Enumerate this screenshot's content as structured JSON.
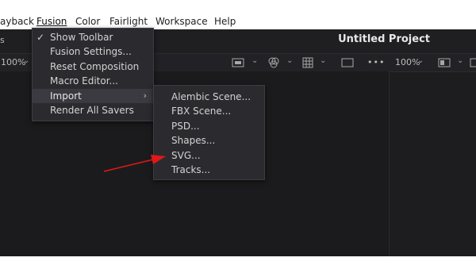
{
  "menubar": {
    "items": [
      "ayback",
      "Fusion",
      "Color",
      "Fairlight",
      "Workspace",
      "Help"
    ]
  },
  "project": {
    "title": "Untitled Project"
  },
  "toolbar": {
    "zoom_left": "100%",
    "zoom_right": "100%",
    "more": "•••"
  },
  "fusion_menu": {
    "items": [
      {
        "label": "Show Toolbar",
        "checked": true
      },
      {
        "label": "Fusion Settings..."
      },
      {
        "label": "Reset Composition"
      },
      {
        "label": "Macro Editor..."
      },
      {
        "label": "Import",
        "submenu": true,
        "highlighted": true
      },
      {
        "label": "Render All Savers"
      }
    ],
    "check_glyph": "✓",
    "submenu_glyph": "›"
  },
  "import_submenu": {
    "items": [
      "Alembic Scene...",
      "FBX Scene...",
      "PSD...",
      "Shapes...",
      "SVG...",
      "Tracks..."
    ]
  },
  "colors": {
    "annotation_arrow": "#e01818",
    "app_background": "#1d1d1f"
  }
}
